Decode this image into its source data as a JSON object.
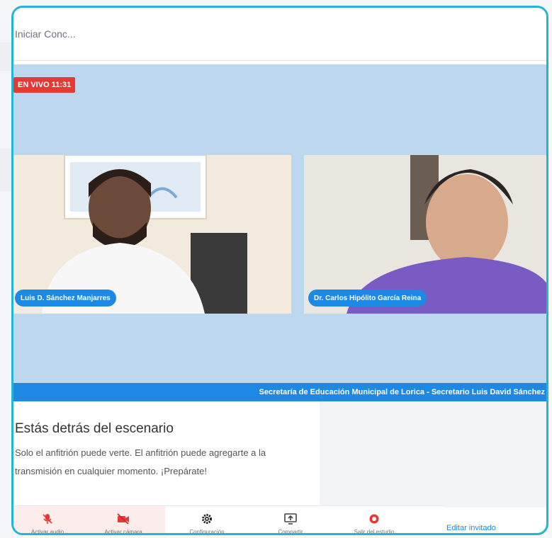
{
  "header": {
    "title": "Iniciar Conc..."
  },
  "stage": {
    "live_badge": "EN VIVO 11:31",
    "participants": [
      {
        "name": "Luis D. Sánchez Manjarres"
      },
      {
        "name": "Dr. Carlos Hipólito García Reina"
      }
    ],
    "ticker": "Secretaría de Educación Municipal de Lorica - Secretario Luis David Sánchez"
  },
  "backstage": {
    "heading": "Estás detrás del escenario",
    "description": "Solo el anfitrión puede verte. El anfitrión puede agregarte a la transmisión en cualquier momento. ¡Prepárate!"
  },
  "controls": [
    {
      "label": "Activar audio",
      "icon": "mic-off-icon",
      "muted": true
    },
    {
      "label": "Activar cámara",
      "icon": "camera-off-icon",
      "muted": true
    },
    {
      "label": "Configuración",
      "icon": "gear-icon",
      "muted": false
    },
    {
      "label": "Compartir",
      "icon": "share-screen-icon",
      "muted": false
    },
    {
      "label": "Salir del estudio",
      "icon": "leave-icon",
      "muted": false
    }
  ],
  "edit_link": "Editar invitado",
  "colors": {
    "accent": "#1e88e5",
    "live": "#e53935",
    "frame": "#23b5d3",
    "stage_bg": "#bcd7ee"
  }
}
